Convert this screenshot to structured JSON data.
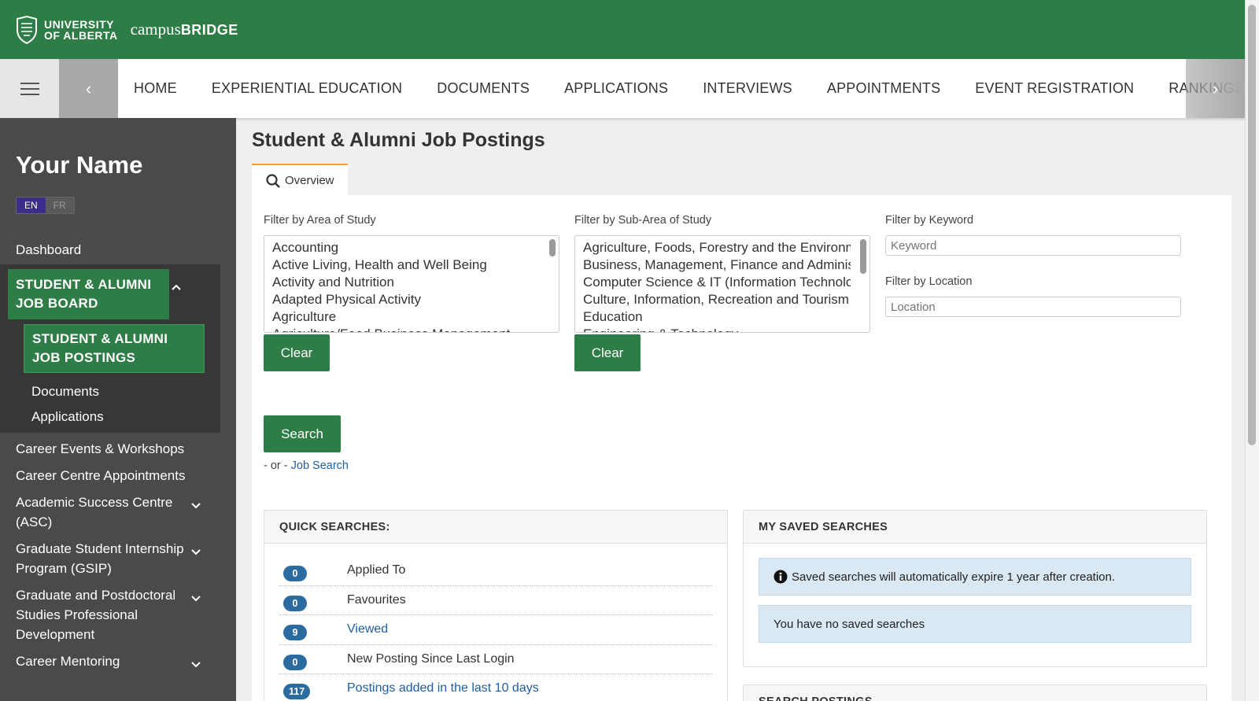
{
  "header": {
    "university": [
      "UNIVERSITY",
      "OF ALBERTA"
    ],
    "product_prefix": "campus",
    "product_suffix": "BRIDGE"
  },
  "nav": {
    "items": [
      "HOME",
      "EXPERIENTIAL EDUCATION",
      "DOCUMENTS",
      "APPLICATIONS",
      "INTERVIEWS",
      "APPOINTMENTS",
      "EVENT REGISTRATION",
      "RANKINGS"
    ]
  },
  "sidebar": {
    "user_name": "Your Name",
    "lang_en": "EN",
    "lang_fr": "FR",
    "dashboard": "Dashboard",
    "job_board": "STUDENT & ALUMNI JOB BOARD",
    "job_postings": "STUDENT & ALUMNI JOB POSTINGS",
    "documents": "Documents",
    "applications": "Applications",
    "career_events": "Career Events & Workshops",
    "career_appointments": "Career Centre Appointments",
    "asc": "Academic Success Centre (ASC)",
    "gsip": "Graduate Student Internship Program (GSIP)",
    "gpsd": "Graduate and Postdoctoral Studies Professional Development",
    "mentoring": "Career Mentoring"
  },
  "main": {
    "title": "Student & Alumni Job Postings",
    "tab_overview": "Overview",
    "filter_area_label": "Filter by Area of Study",
    "area_options": [
      "Accounting",
      "Active Living, Health and Well Being",
      "Activity and Nutrition",
      "Adapted Physical Activity",
      "Agriculture",
      "Agriculture/Food Business Management"
    ],
    "filter_subarea_label": "Filter by Sub-Area of Study",
    "subarea_options": [
      "Agriculture, Foods, Forestry and the Environment",
      "Business, Management, Finance and Administration",
      "Computer Science & IT (Information Technology)",
      "Culture, Information, Recreation and Tourism",
      "Education",
      "Engineering & Technology"
    ],
    "clear_label": "Clear",
    "filter_keyword_label": "Filter by Keyword",
    "keyword_placeholder": "Keyword",
    "filter_location_label": "Filter by Location",
    "location_placeholder": "Location",
    "search_label": "Search",
    "or_text": "- or -",
    "job_search_link": "Job Search"
  },
  "quick_searches": {
    "heading": "QUICK SEARCHES:",
    "rows": [
      {
        "count": "0",
        "label": "Applied To"
      },
      {
        "count": "0",
        "label": "Favourites"
      },
      {
        "count": "9",
        "label": "Viewed"
      },
      {
        "count": "0",
        "label": "New Posting Since Last Login"
      },
      {
        "count": "117",
        "label": "Postings added in the last 10 days"
      }
    ]
  },
  "saved_searches": {
    "heading": "MY SAVED SEARCHES",
    "info": "Saved searches will automatically expire 1 year after creation.",
    "empty": "You have no saved searches"
  },
  "search_postings": {
    "heading": "SEARCH POSTINGS"
  },
  "colors": {
    "brand_green": "#2e7d46",
    "sidebar_bg": "#4a4a4a",
    "badge_blue": "#2b6ba0",
    "link_blue": "#1f5fa0",
    "tab_accent": "#f0a040"
  }
}
